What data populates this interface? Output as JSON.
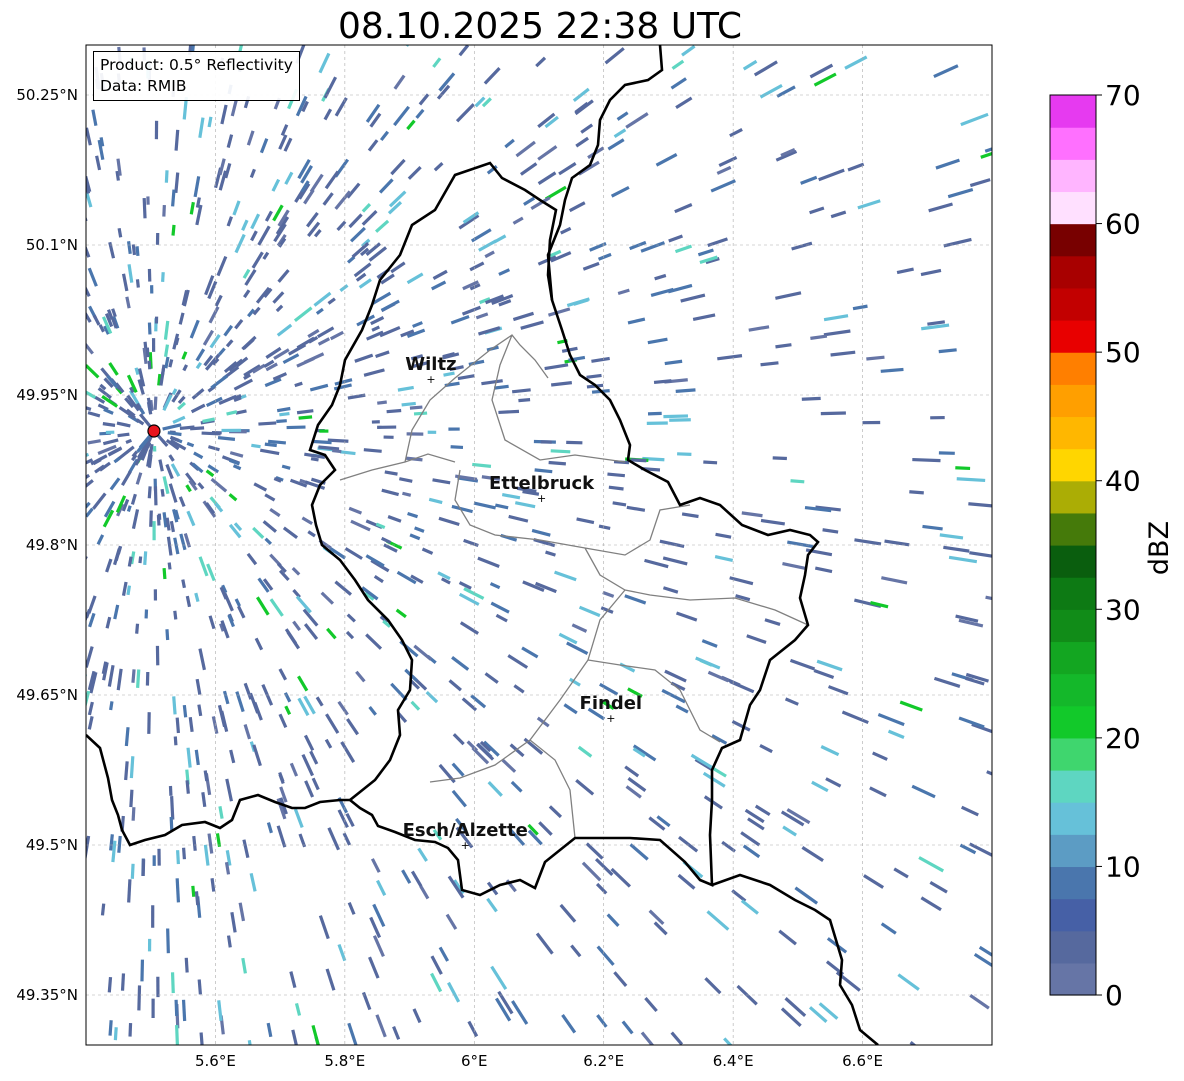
{
  "title": "08.10.2025 22:38 UTC",
  "info": {
    "product": "Product: 0.5° Reflectivity",
    "data": "Data: RMIB"
  },
  "map": {
    "extent": {
      "lon_min": 5.4,
      "lon_max": 6.8,
      "lat_min": 49.3,
      "lat_max": 50.3
    },
    "lon_ticks": [
      5.6,
      5.8,
      6.0,
      6.2,
      6.4,
      6.6
    ],
    "lon_tick_labels": [
      "5.6°E",
      "5.8°E",
      "6°E",
      "6.2°E",
      "6.4°E",
      "6.6°E"
    ],
    "lat_ticks": [
      50.25,
      50.1,
      49.95,
      49.8,
      49.65,
      49.5,
      49.35
    ],
    "lat_tick_labels": [
      "50.25°N",
      "50.1°N",
      "49.95°N",
      "49.8°N",
      "49.65°N",
      "49.5°N",
      "49.35°N"
    ],
    "radar_site": {
      "lon": 5.505,
      "lat": 49.914,
      "color": "#e8141e"
    },
    "cities": [
      {
        "name": "Wiltz",
        "lon": 5.933,
        "lat": 49.966
      },
      {
        "name": "Ettelbruck",
        "lon": 6.104,
        "lat": 49.847
      },
      {
        "name": "Findel",
        "lon": 6.211,
        "lat": 49.627
      },
      {
        "name": "Esch/Alzette",
        "lon": 5.986,
        "lat": 49.5
      }
    ],
    "border_color": "#000000",
    "canton_color": "#808080"
  },
  "colorbar": {
    "label": "dBZ",
    "min": 0,
    "max": 70,
    "ticks": [
      0,
      10,
      20,
      30,
      40,
      50,
      60,
      70
    ],
    "tick_labels": [
      "0",
      "10",
      "20",
      "30",
      "40",
      "50",
      "60",
      "70"
    ],
    "colors": [
      "#6675a6",
      "#56699e",
      "#4660a6",
      "#4a76ad",
      "#5c9cc4",
      "#66c1d9",
      "#5ed6c1",
      "#3fd66e",
      "#12c92a",
      "#14b82a",
      "#13a621",
      "#118c18",
      "#0d7a14",
      "#0a5e0e",
      "#457a0a",
      "#abad05",
      "#ffd600",
      "#ffb700",
      "#ff9f00",
      "#ff7f00",
      "#e80000",
      "#c20000",
      "#a80000",
      "#780000",
      "#ffe0ff",
      "#ffb5ff",
      "#ff70ff",
      "#e63af0"
    ]
  }
}
